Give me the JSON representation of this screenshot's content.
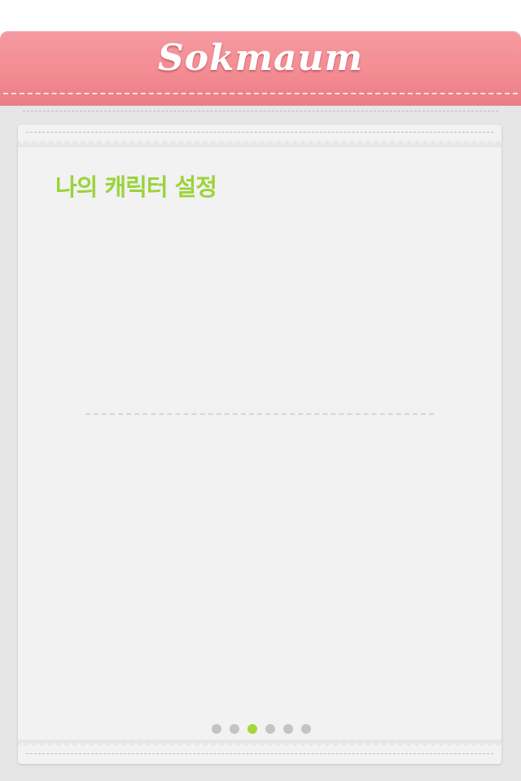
{
  "header": {
    "title": "Sokmaum",
    "color": "#f48c93"
  },
  "section": {
    "title": "나의 캐릭터 설정",
    "title_color": "#9cd33b"
  },
  "pager": {
    "page_count": 6,
    "current_page": 3,
    "active_color": "#a6d63a",
    "inactive_color": "#c4c4c4"
  }
}
